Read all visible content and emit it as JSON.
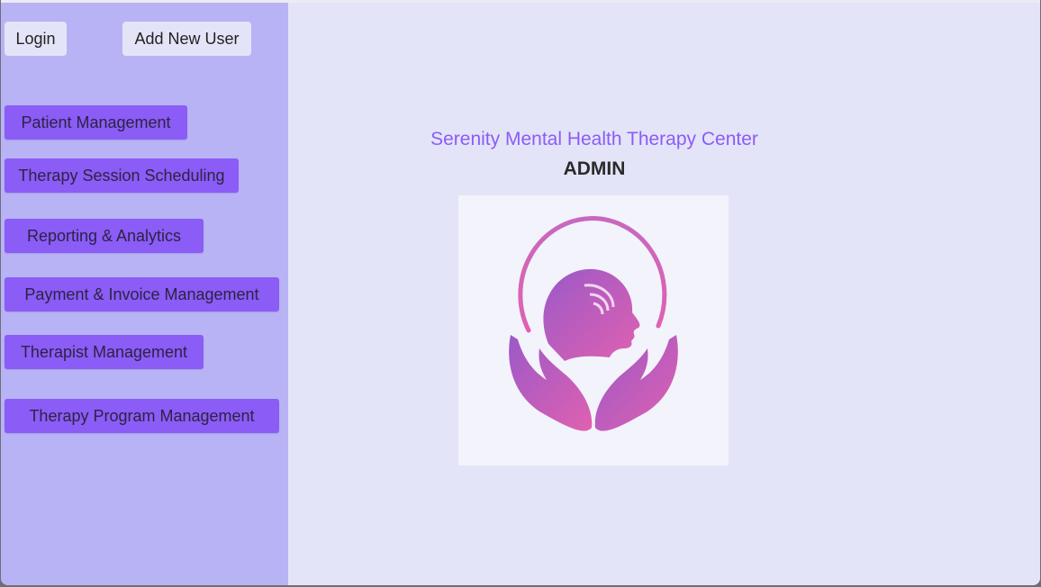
{
  "header": {
    "login_label": "Login",
    "add_user_label": "Add New User"
  },
  "sidebar": {
    "items": [
      {
        "label": "Patient Management"
      },
      {
        "label": "Therapy Session Scheduling"
      },
      {
        "label": "Reporting & Analytics"
      },
      {
        "label": "Payment & Invoice Management"
      },
      {
        "label": "Therapist Management"
      },
      {
        "label": "Therapy Program Management"
      }
    ]
  },
  "main": {
    "title": "Serenity Mental Health Therapy Center",
    "role": "ADMIN",
    "logo_icon": "head-in-hands-logo"
  },
  "colors": {
    "accent": "#8b5cf6",
    "sidebar_bg": "#b8b3f4",
    "main_bg": "#e4e4f8",
    "logo_pink": "#e061b0",
    "logo_purple": "#9b59c8"
  }
}
